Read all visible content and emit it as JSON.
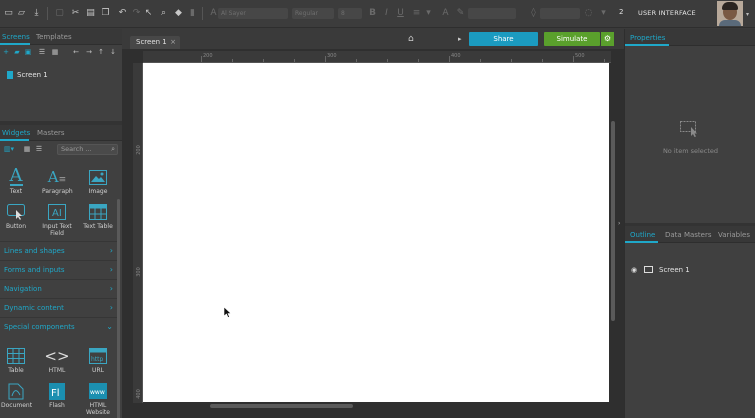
{
  "toolbar": {
    "font_name": "Al Sayer",
    "font_weight": "Regular",
    "font_size": "8",
    "user_count": "2",
    "user_name": "USER INTERFACE"
  },
  "left_panel": {
    "tabs_top": [
      "Screens",
      "Templates"
    ],
    "screens": [
      {
        "label": "Screen 1"
      }
    ],
    "tabs_widgets": [
      "Widgets",
      "Masters"
    ],
    "search_placeholder": "Search ...",
    "widgets_basic": [
      {
        "label": "Text",
        "icon": "text-icon"
      },
      {
        "label": "Paragraph",
        "icon": "paragraph-icon"
      },
      {
        "label": "Image",
        "icon": "image-icon"
      },
      {
        "label": "Button",
        "icon": "button-icon"
      },
      {
        "label": "Input Text Field",
        "icon": "input-text-icon"
      },
      {
        "label": "Text Table",
        "icon": "text-table-icon"
      }
    ],
    "categories": [
      "Lines and shapes",
      "Forms and inputs",
      "Navigation",
      "Dynamic content",
      "Special components"
    ],
    "widgets_special": [
      {
        "label": "Table",
        "icon": "table-icon"
      },
      {
        "label": "HTML",
        "icon": "html-icon"
      },
      {
        "label": "URL",
        "icon": "url-icon"
      },
      {
        "label": "Document",
        "icon": "document-icon"
      },
      {
        "label": "Flash",
        "icon": "flash-icon"
      },
      {
        "label": "HTML Website",
        "icon": "html-website-icon"
      }
    ]
  },
  "canvas": {
    "tab_label": "Screen 1",
    "share_label": "Share",
    "simulate_label": "Simulate",
    "ruler_top": [
      "200",
      "300",
      "400",
      "500"
    ],
    "ruler_left": [
      "200",
      "300",
      "400"
    ]
  },
  "right_panel": {
    "tab_properties": "Properties",
    "no_item_text": "No item selected",
    "tabs_bottom": [
      "Outline",
      "Data Masters",
      "Variables"
    ],
    "outline_items": [
      {
        "label": "Screen 1"
      }
    ]
  },
  "colors": {
    "accent": "#1fa8c9",
    "share": "#1b9bc0",
    "simulate": "#5aa02c"
  }
}
